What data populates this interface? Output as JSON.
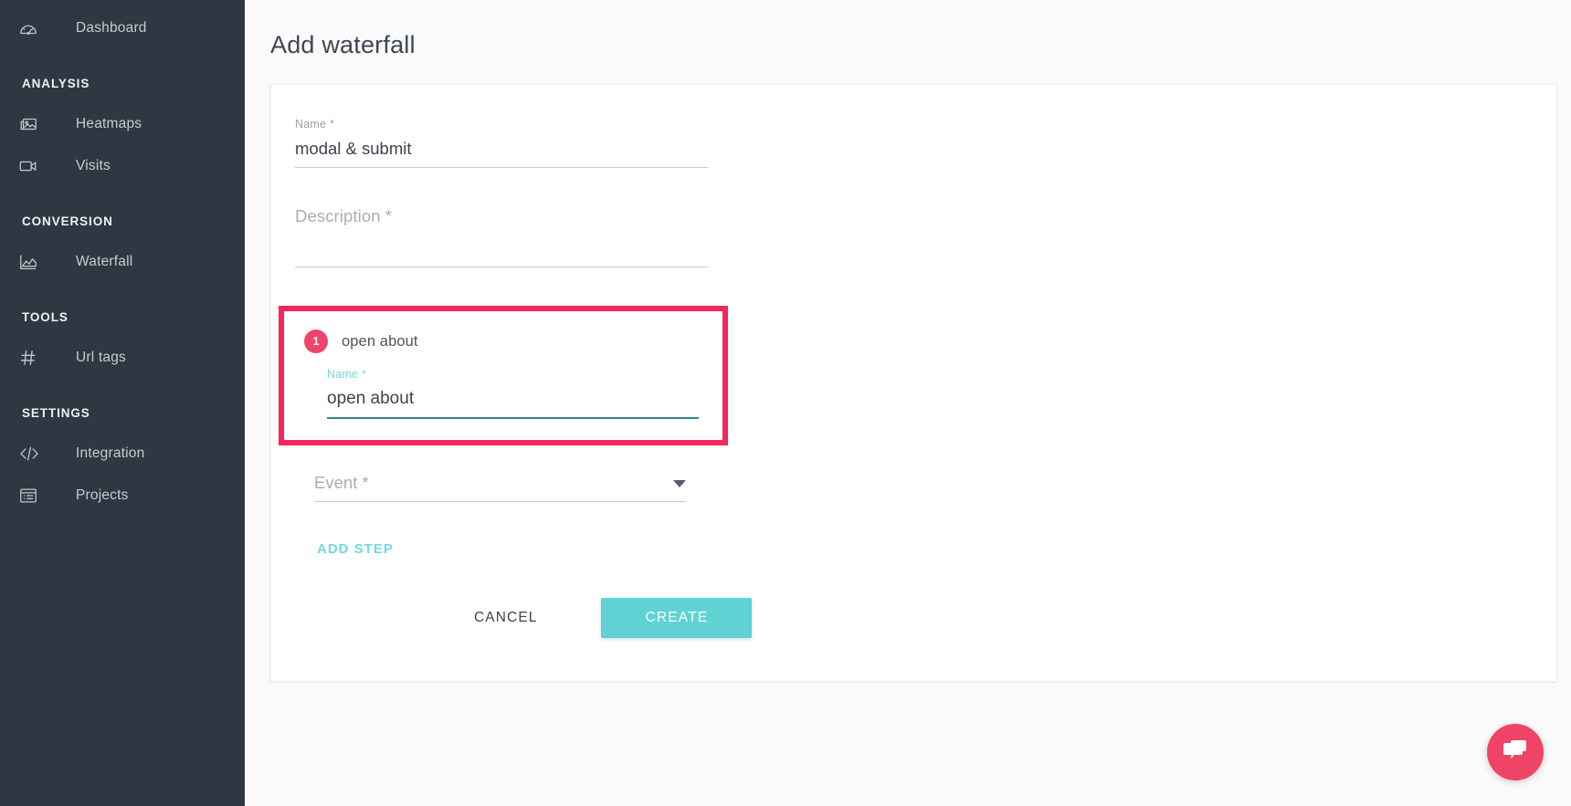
{
  "sidebar": {
    "items": [
      {
        "label": "Dashboard",
        "icon": "gauge-icon",
        "kind": "link"
      },
      {
        "label": "ANALYSIS",
        "kind": "section"
      },
      {
        "label": "Heatmaps",
        "icon": "image-icon",
        "kind": "link"
      },
      {
        "label": "Visits",
        "icon": "video-camera-icon",
        "kind": "link"
      },
      {
        "label": "CONVERSION",
        "kind": "section"
      },
      {
        "label": "Waterfall",
        "icon": "area-chart-icon",
        "kind": "link"
      },
      {
        "label": "TOOLS",
        "kind": "section"
      },
      {
        "label": "Url tags",
        "icon": "hash-icon",
        "kind": "link"
      },
      {
        "label": "SETTINGS",
        "kind": "section"
      },
      {
        "label": "Integration",
        "icon": "code-icon",
        "kind": "link"
      },
      {
        "label": "Projects",
        "icon": "list-icon",
        "kind": "link"
      }
    ]
  },
  "page": {
    "title": "Add waterfall"
  },
  "form": {
    "name": {
      "label": "Name *",
      "value": "modal & submit",
      "placeholder": "Name *"
    },
    "description": {
      "label": "Description *",
      "value": "",
      "placeholder": "Description *"
    },
    "step": {
      "badge": "1",
      "title": "open about",
      "name": {
        "label": "Name *",
        "value": "open about",
        "placeholder": "Name *"
      }
    },
    "event": {
      "label": "Event *",
      "value": "",
      "placeholder": "Event *",
      "options": []
    },
    "add_step_label": "ADD STEP",
    "cancel_label": "CANCEL",
    "create_label": "CREATE"
  },
  "colors": {
    "sidebar_bg": "#2f3742",
    "accent_teal": "#5fd3d4",
    "focus_underline": "#2b8a8f",
    "highlight_border": "#f7255f",
    "badge_pink": "#ef436b",
    "chat_pink": "#ef4465"
  },
  "chat": {
    "label": "Open chat"
  }
}
